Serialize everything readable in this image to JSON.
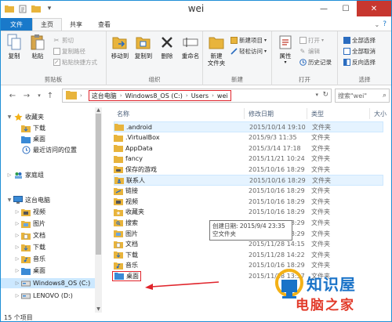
{
  "window": {
    "title": "wei"
  },
  "tabs": [
    {
      "label": "文件"
    },
    {
      "label": "主页"
    },
    {
      "label": "共享"
    },
    {
      "label": "查看"
    }
  ],
  "ribbon": {
    "clipboard": {
      "label": "剪贴板",
      "copy": "复制",
      "paste": "粘贴",
      "cut": "剪切",
      "copy_path": "复制路径",
      "paste_shortcut": "粘贴快捷方式"
    },
    "organize": {
      "label": "组织",
      "move_to": "移动到",
      "copy_to": "复制到",
      "delete": "删除",
      "rename": "重命名"
    },
    "new": {
      "label": "新建",
      "new_folder": "新建\n文件夹",
      "new_item": "新建项目",
      "easy_access": "轻松访问"
    },
    "open": {
      "label": "打开",
      "properties": "属性",
      "open": "打开",
      "edit": "编辑",
      "history": "历史记录"
    },
    "select": {
      "label": "选择",
      "select_all": "全部选择",
      "select_none": "全部取消",
      "invert": "反向选择"
    }
  },
  "address": {
    "crumbs": [
      "这台电脑",
      "Windows8_OS (C:)",
      "Users",
      "wei"
    ],
    "search_placeholder": "搜索\"wei\""
  },
  "nav": [
    {
      "label": "收藏夹",
      "icon": "star-icon",
      "level": 0,
      "arrow": "▼"
    },
    {
      "label": "下载",
      "icon": "download-folder-icon",
      "level": 1
    },
    {
      "label": "桌面",
      "icon": "desktop-folder-icon",
      "level": 1
    },
    {
      "label": "最近访问的位置",
      "icon": "recent-places-icon",
      "level": 1
    },
    {
      "label": "家庭组",
      "icon": "homegroup-icon",
      "level": 0,
      "arrow": "▷"
    },
    {
      "label": "这台电脑",
      "icon": "computer-icon",
      "level": 0,
      "arrow": "▼"
    },
    {
      "label": "视频",
      "icon": "video-folder-icon",
      "level": 1,
      "arrow": "▷"
    },
    {
      "label": "图片",
      "icon": "pictures-folder-icon",
      "level": 1,
      "arrow": "▷"
    },
    {
      "label": "文档",
      "icon": "documents-folder-icon",
      "level": 1,
      "arrow": "▷"
    },
    {
      "label": "下载",
      "icon": "download-folder-icon",
      "level": 1,
      "arrow": "▷"
    },
    {
      "label": "音乐",
      "icon": "music-folder-icon",
      "level": 1,
      "arrow": "▷"
    },
    {
      "label": "桌面",
      "icon": "desktop-folder-icon",
      "level": 1,
      "arrow": "▷"
    },
    {
      "label": "Windows8_OS (C:)",
      "icon": "drive-icon",
      "level": 1,
      "arrow": "▷",
      "selected": true
    },
    {
      "label": "LENOVO (D:)",
      "icon": "drive-icon",
      "level": 1,
      "arrow": "▷"
    }
  ],
  "columns": {
    "name": "名称",
    "date": "修改日期",
    "type": "类型",
    "size": "大小"
  },
  "files": [
    {
      "name": ".android",
      "date": "2015/10/14 19:10",
      "type": "文件夹",
      "icon": "folder-icon",
      "highlight": true
    },
    {
      "name": ".VirtualBox",
      "date": "2015/9/3 11:35",
      "type": "文件夹",
      "icon": "folder-icon"
    },
    {
      "name": "AppData",
      "date": "2015/3/14 17:18",
      "type": "文件夹",
      "icon": "folder-icon"
    },
    {
      "name": "fancy",
      "date": "2015/11/21 10:24",
      "type": "文件夹",
      "icon": "folder-icon"
    },
    {
      "name": "保存的游戏",
      "date": "2015/10/16 18:29",
      "type": "文件夹",
      "icon": "saved-games-icon"
    },
    {
      "name": "联系人",
      "date": "2015/10/16 18:29",
      "type": "文件夹",
      "icon": "contacts-icon",
      "highlight": true
    },
    {
      "name": "链接",
      "date": "2015/10/16 18:29",
      "type": "文件夹",
      "icon": "links-icon"
    },
    {
      "name": "视频",
      "date": "2015/10/16 18:29",
      "type": "文件夹",
      "icon": "video-folder-icon"
    },
    {
      "name": "收藏夹",
      "date": "2015/10/16 18:29",
      "type": "文件夹",
      "icon": "favorites-folder-icon"
    },
    {
      "name": "搜索",
      "date": "2015/10/16 18:29",
      "type": "文件夹",
      "icon": "search-folder-icon"
    },
    {
      "name": "图片",
      "date": "2015/10/16 18:29",
      "type": "文件夹",
      "icon": "pictures-folder-icon"
    },
    {
      "name": "文档",
      "date": "2015/11/28 14:15",
      "type": "文件夹",
      "icon": "documents-folder-icon"
    },
    {
      "name": "下载",
      "date": "2015/11/28 14:22",
      "type": "文件夹",
      "icon": "download-folder-icon"
    },
    {
      "name": "音乐",
      "date": "2015/10/16 18:29",
      "type": "文件夹",
      "icon": "music-folder-icon"
    },
    {
      "name": "桌面",
      "date": "2015/11/28 13:57",
      "type": "文件夹",
      "icon": "desktop-folder-icon",
      "boxed": true
    }
  ],
  "tooltip": {
    "line1": "创建日期: 2015/9/4 23:35",
    "line2": "空文件夹"
  },
  "status": {
    "count": "15 个项目"
  },
  "watermark": {
    "line1": "知识屋",
    "line2": "电脑之家"
  },
  "colors": {
    "accent": "#1979ca",
    "annotation": "#e0242b",
    "selection": "#cce8ff",
    "folder": "#e8b43c"
  }
}
